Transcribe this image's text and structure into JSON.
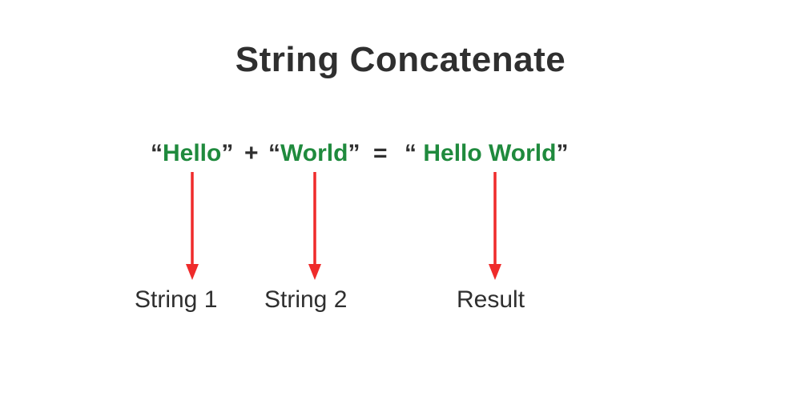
{
  "title": "String Concatenate",
  "expression": {
    "open_quote": "“",
    "close_quote": "”",
    "plus": " + ",
    "equals": "  = ",
    "string1": "Hello",
    "string2": "World",
    "result_leading_space": " ",
    "result": "Hello World"
  },
  "labels": {
    "string1": "String 1",
    "string2": "String 2",
    "result": "Result"
  },
  "colors": {
    "text": "#2f2f2f",
    "word": "#1f8a3d",
    "arrow": "#ef2b2b"
  }
}
